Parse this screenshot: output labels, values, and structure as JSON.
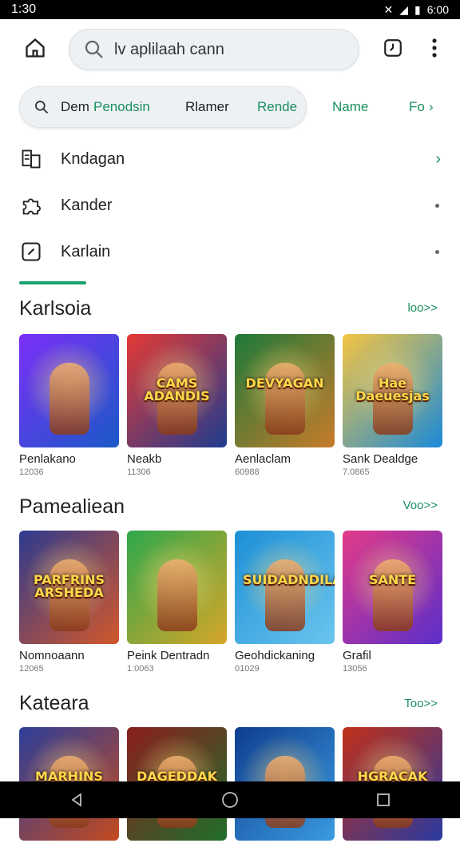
{
  "status_bar": {
    "time": "1:30",
    "battery_text": "6:00"
  },
  "header": {
    "search_text": "lv aplilaah cann",
    "home_icon": "home-icon",
    "timer_icon": "timer-icon",
    "more_icon": "more-vert-icon"
  },
  "chips": [
    {
      "label": "Dem",
      "accent": "Penodsin"
    },
    {
      "label": "Rlamer"
    },
    {
      "label": "Rende"
    },
    {
      "label": "Name"
    },
    {
      "label": "Fo"
    }
  ],
  "menu": [
    {
      "label": "Kndagan",
      "icon": "library-icon",
      "trail": "chevron"
    },
    {
      "label": "Kander",
      "icon": "puzzle-icon",
      "trail": "dot"
    },
    {
      "label": "Karlain",
      "icon": "compass-icon",
      "trail": "dot"
    }
  ],
  "sections": [
    {
      "title": "Karlsoia",
      "more": "loo>>",
      "apps": [
        {
          "name": "Penlakano",
          "meta": "12036",
          "badge": "",
          "colors": [
            "#7b2ff7",
            "#1b59c7"
          ]
        },
        {
          "name": "Neakb",
          "meta": "11306",
          "badge": "CAMS ADANDIS",
          "colors": [
            "#e53935",
            "#1e3c8f"
          ]
        },
        {
          "name": "Aenlaclam",
          "meta": "60988",
          "badge": "DEVYAGAN",
          "colors": [
            "#1e7a3a",
            "#c87b2a"
          ]
        },
        {
          "name": "Sank Dealdge",
          "meta": "7.0865",
          "badge": "Hae Daeuesjas",
          "colors": [
            "#f5c542",
            "#1b8ad8"
          ]
        }
      ]
    },
    {
      "title": "Pamealiean",
      "more": "Voo>>",
      "apps": [
        {
          "name": "Nomnoaann",
          "meta": "12065",
          "badge": "PARFRINS ARSHEDA",
          "colors": [
            "#2e3a8f",
            "#d2582a"
          ]
        },
        {
          "name": "Peink Dentradn",
          "meta": "1:0063",
          "badge": "",
          "colors": [
            "#2ea84b",
            "#d7a52a"
          ]
        },
        {
          "name": "Geohdickaning",
          "meta": "01029",
          "badge": "SUIDADNDILAN",
          "colors": [
            "#1d8fd6",
            "#6bc5ee"
          ]
        },
        {
          "name": "Grafil",
          "meta": "13056",
          "badge": "SANTE",
          "colors": [
            "#e23a8a",
            "#5b2fc9"
          ]
        }
      ]
    },
    {
      "title": "Kateara",
      "more": "Too>>",
      "apps": [
        {
          "name": "",
          "meta": "",
          "badge": "MARHINS",
          "colors": [
            "#2c3e9a",
            "#c44a1f"
          ]
        },
        {
          "name": "",
          "meta": "",
          "badge": "DAGEDDAK",
          "colors": [
            "#8b1e1e",
            "#1f6e2a"
          ]
        },
        {
          "name": "",
          "meta": "",
          "badge": "",
          "colors": [
            "#0f3d8f",
            "#3a9be0"
          ]
        },
        {
          "name": "",
          "meta": "",
          "badge": "HGRACAK",
          "colors": [
            "#c03018",
            "#2a3aa0"
          ]
        }
      ]
    }
  ],
  "accent_color": "#1a8f5f"
}
